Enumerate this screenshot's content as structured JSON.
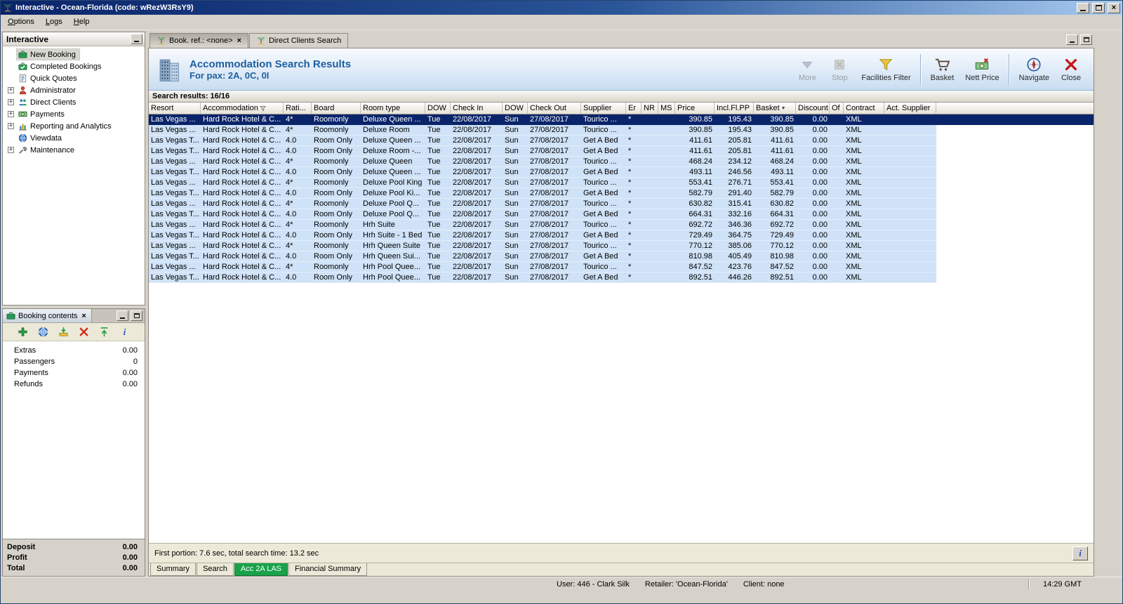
{
  "window": {
    "title": "Interactive - Ocean-Florida (code: wRezW3RsY9)"
  },
  "menubar": {
    "items": [
      "Options",
      "Logs",
      "Help"
    ]
  },
  "sidebar": {
    "title": "Interactive",
    "items": [
      {
        "label": "New Booking",
        "icon": "booking-icon",
        "expandable": false,
        "selected": true
      },
      {
        "label": "Completed Bookings",
        "icon": "completed-icon",
        "expandable": false,
        "selected": false
      },
      {
        "label": "Quick Quotes",
        "icon": "quotes-icon",
        "expandable": false,
        "selected": false
      },
      {
        "label": "Administrator",
        "icon": "admin-icon",
        "expandable": true,
        "selected": false
      },
      {
        "label": "Direct Clients",
        "icon": "clients-icon",
        "expandable": true,
        "selected": false
      },
      {
        "label": "Payments",
        "icon": "payments-icon",
        "expandable": true,
        "selected": false
      },
      {
        "label": "Reporting and Analytics",
        "icon": "reports-icon",
        "expandable": true,
        "selected": false
      },
      {
        "label": "Viewdata",
        "icon": "viewdata-icon",
        "expandable": false,
        "selected": false
      },
      {
        "label": "Maintenance",
        "icon": "maintenance-icon",
        "expandable": true,
        "selected": false
      }
    ]
  },
  "booking_contents": {
    "title": "Booking contents",
    "toolbar": [
      {
        "icon": "add-icon"
      },
      {
        "icon": "web-icon"
      },
      {
        "icon": "import-icon"
      },
      {
        "icon": "delete-icon"
      },
      {
        "icon": "upload-icon"
      },
      {
        "icon": "info-icon"
      }
    ],
    "rows": [
      {
        "label": "Extras",
        "value": "0.00"
      },
      {
        "label": "Passengers",
        "value": "0"
      },
      {
        "label": "Payments",
        "value": "0.00"
      },
      {
        "label": "Refunds",
        "value": "0.00"
      }
    ],
    "totals": [
      {
        "label": "Deposit",
        "value": "0.00"
      },
      {
        "label": "Profit",
        "value": "0.00"
      },
      {
        "label": "Total",
        "value": "0.00"
      }
    ]
  },
  "document_tabs": [
    {
      "label": "Book. ref.: <none>",
      "active": true,
      "closable": true
    },
    {
      "label": "Direct Clients Search",
      "active": false,
      "closable": false
    }
  ],
  "results_header": {
    "title": "Accommodation Search Results",
    "subtitle": "For pax: 2A, 0C, 0I"
  },
  "toolbar": {
    "buttons": [
      {
        "label": "More",
        "icon": "more-icon",
        "disabled": true,
        "separator_before": false
      },
      {
        "label": "Stop",
        "icon": "stop-icon",
        "disabled": true,
        "separator_before": false
      },
      {
        "label": "Facilities Filter",
        "icon": "filter-icon",
        "disabled": false,
        "separator_before": false
      },
      {
        "label": "Basket",
        "icon": "basket-icon",
        "disabled": false,
        "separator_before": true
      },
      {
        "label": "Nett Price",
        "icon": "nett-price-icon",
        "disabled": false,
        "separator_before": false
      },
      {
        "label": "Navigate",
        "icon": "navigate-icon",
        "disabled": false,
        "separator_before": true
      },
      {
        "label": "Close",
        "icon": "close-icon",
        "disabled": false,
        "separator_before": false
      }
    ]
  },
  "results_bar": {
    "label": "Search results: 16/16"
  },
  "results_table": {
    "columns": [
      "Resort",
      "Accommodation",
      "Rati...",
      "Board",
      "Room type",
      "DOW",
      "Check In",
      "DOW",
      "Check Out",
      "Supplier",
      "Er",
      "NR",
      "MS",
      "Price",
      "Incl.Fl.PP",
      "Basket",
      "Discount",
      "Of",
      "Contract",
      "Act. Supplier"
    ],
    "filter_column": "Accommodation",
    "sort_column": "Basket",
    "selected_row_index": 0,
    "rows": [
      [
        "Las Vegas ...",
        "Hard Rock Hotel & C...",
        "4*",
        "Roomonly",
        "Deluxe Queen ...",
        "Tue",
        "22/08/2017",
        "Sun",
        "27/08/2017",
        "Tourico ...",
        "*",
        "",
        "",
        "390.85",
        "195.43",
        "390.85",
        "0.00",
        "",
        "XML",
        ""
      ],
      [
        "Las Vegas ...",
        "Hard Rock Hotel & C...",
        "4*",
        "Roomonly",
        "Deluxe Room",
        "Tue",
        "22/08/2017",
        "Sun",
        "27/08/2017",
        "Tourico ...",
        "*",
        "",
        "",
        "390.85",
        "195.43",
        "390.85",
        "0.00",
        "",
        "XML",
        ""
      ],
      [
        "Las Vegas T...",
        "Hard Rock Hotel & C...",
        "4.0",
        "Room Only",
        "Deluxe Queen ...",
        "Tue",
        "22/08/2017",
        "Sun",
        "27/08/2017",
        "Get A Bed",
        "*",
        "",
        "",
        "411.61",
        "205.81",
        "411.61",
        "0.00",
        "",
        "XML",
        ""
      ],
      [
        "Las Vegas T...",
        "Hard Rock Hotel & C...",
        "4.0",
        "Room Only",
        "Deluxe Room -...",
        "Tue",
        "22/08/2017",
        "Sun",
        "27/08/2017",
        "Get A Bed",
        "*",
        "",
        "",
        "411.61",
        "205.81",
        "411.61",
        "0.00",
        "",
        "XML",
        ""
      ],
      [
        "Las Vegas ...",
        "Hard Rock Hotel & C...",
        "4*",
        "Roomonly",
        "Deluxe Queen",
        "Tue",
        "22/08/2017",
        "Sun",
        "27/08/2017",
        "Tourico ...",
        "*",
        "",
        "",
        "468.24",
        "234.12",
        "468.24",
        "0.00",
        "",
        "XML",
        ""
      ],
      [
        "Las Vegas T...",
        "Hard Rock Hotel & C...",
        "4.0",
        "Room Only",
        "Deluxe Queen ...",
        "Tue",
        "22/08/2017",
        "Sun",
        "27/08/2017",
        "Get A Bed",
        "*",
        "",
        "",
        "493.11",
        "246.56",
        "493.11",
        "0.00",
        "",
        "XML",
        ""
      ],
      [
        "Las Vegas ...",
        "Hard Rock Hotel & C...",
        "4*",
        "Roomonly",
        "Deluxe Pool King",
        "Tue",
        "22/08/2017",
        "Sun",
        "27/08/2017",
        "Tourico ...",
        "*",
        "",
        "",
        "553.41",
        "276.71",
        "553.41",
        "0.00",
        "",
        "XML",
        ""
      ],
      [
        "Las Vegas T...",
        "Hard Rock Hotel & C...",
        "4.0",
        "Room Only",
        "Deluxe Pool Ki...",
        "Tue",
        "22/08/2017",
        "Sun",
        "27/08/2017",
        "Get A Bed",
        "*",
        "",
        "",
        "582.79",
        "291.40",
        "582.79",
        "0.00",
        "",
        "XML",
        ""
      ],
      [
        "Las Vegas ...",
        "Hard Rock Hotel & C...",
        "4*",
        "Roomonly",
        "Deluxe Pool Q...",
        "Tue",
        "22/08/2017",
        "Sun",
        "27/08/2017",
        "Tourico ...",
        "*",
        "",
        "",
        "630.82",
        "315.41",
        "630.82",
        "0.00",
        "",
        "XML",
        ""
      ],
      [
        "Las Vegas T...",
        "Hard Rock Hotel & C...",
        "4.0",
        "Room Only",
        "Deluxe Pool Q...",
        "Tue",
        "22/08/2017",
        "Sun",
        "27/08/2017",
        "Get A Bed",
        "*",
        "",
        "",
        "664.31",
        "332.16",
        "664.31",
        "0.00",
        "",
        "XML",
        ""
      ],
      [
        "Las Vegas ...",
        "Hard Rock Hotel & C...",
        "4*",
        "Roomonly",
        "Hrh Suite",
        "Tue",
        "22/08/2017",
        "Sun",
        "27/08/2017",
        "Tourico ...",
        "*",
        "",
        "",
        "692.72",
        "346.36",
        "692.72",
        "0.00",
        "",
        "XML",
        ""
      ],
      [
        "Las Vegas T...",
        "Hard Rock Hotel & C...",
        "4.0",
        "Room Only",
        "Hrh Suite - 1 Bed",
        "Tue",
        "22/08/2017",
        "Sun",
        "27/08/2017",
        "Get A Bed",
        "*",
        "",
        "",
        "729.49",
        "364.75",
        "729.49",
        "0.00",
        "",
        "XML",
        ""
      ],
      [
        "Las Vegas ...",
        "Hard Rock Hotel & C...",
        "4*",
        "Roomonly",
        "Hrh Queen Suite",
        "Tue",
        "22/08/2017",
        "Sun",
        "27/08/2017",
        "Tourico ...",
        "*",
        "",
        "",
        "770.12",
        "385.06",
        "770.12",
        "0.00",
        "",
        "XML",
        ""
      ],
      [
        "Las Vegas T...",
        "Hard Rock Hotel & C...",
        "4.0",
        "Room Only",
        "Hrh Queen Sui...",
        "Tue",
        "22/08/2017",
        "Sun",
        "27/08/2017",
        "Get A Bed",
        "*",
        "",
        "",
        "810.98",
        "405.49",
        "810.98",
        "0.00",
        "",
        "XML",
        ""
      ],
      [
        "Las Vegas ...",
        "Hard Rock Hotel & C...",
        "4*",
        "Roomonly",
        "Hrh Pool Quee...",
        "Tue",
        "22/08/2017",
        "Sun",
        "27/08/2017",
        "Tourico ...",
        "*",
        "",
        "",
        "847.52",
        "423.76",
        "847.52",
        "0.00",
        "",
        "XML",
        ""
      ],
      [
        "Las Vegas T...",
        "Hard Rock Hotel & C...",
        "4.0",
        "Room Only",
        "Hrh Pool Quee...",
        "Tue",
        "22/08/2017",
        "Sun",
        "27/08/2017",
        "Get A Bed",
        "*",
        "",
        "",
        "892.51",
        "446.26",
        "892.51",
        "0.00",
        "",
        "XML",
        ""
      ]
    ]
  },
  "search_status": {
    "label": "First portion: 7.6 sec, total search time: 13.2 sec"
  },
  "bottom_tabs": [
    {
      "label": "Summary",
      "active": false
    },
    {
      "label": "Search",
      "active": false
    },
    {
      "label": "Acc 2A LAS",
      "active": true
    },
    {
      "label": "Financial Summary",
      "active": false
    }
  ],
  "statusbar": {
    "user": "User: 446 - Clark Silk",
    "retailer": "Retailer: 'Ocean-Florida'",
    "client": "Client: none",
    "time": "14:29 GMT"
  },
  "colors": {
    "selection": "#0a246a",
    "row_blue": "#cfe2f7",
    "active_tab_green": "#19a24a",
    "header_title_blue": "#1f5f9e"
  }
}
